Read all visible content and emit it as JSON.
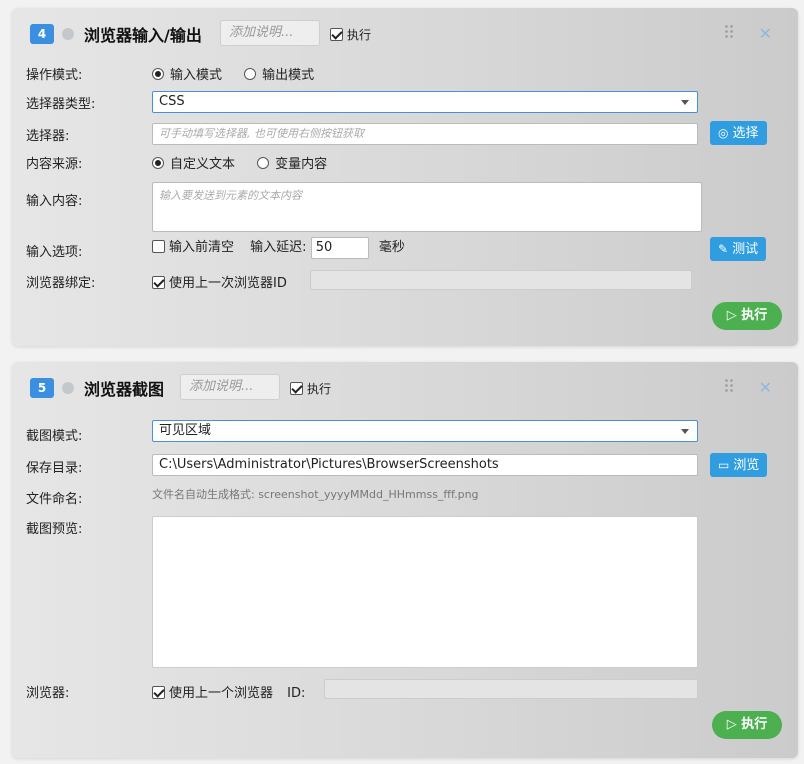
{
  "card1": {
    "index": "4",
    "title": "浏览器输入/输出",
    "desc_placeholder": "添加说明...",
    "exec_label": "执行",
    "op_mode": {
      "label": "操作模式:",
      "opt_input": "输入模式",
      "opt_output": "输出模式"
    },
    "selector_type": {
      "label": "选择器类型:",
      "value": "CSS"
    },
    "selector": {
      "label": "选择器:",
      "placeholder": "可手动填写选择器, 也可使用右侧按钮获取",
      "button": "选择"
    },
    "content_source": {
      "label": "内容来源:",
      "opt_custom": "自定义文本",
      "opt_variable": "变量内容"
    },
    "input_content": {
      "label": "输入内容:",
      "placeholder": "输入要发送到元素的文本内容"
    },
    "input_options": {
      "label": "输入选项:",
      "clear_label": "输入前清空",
      "delay_label": "输入延迟:",
      "delay_value": "50",
      "delay_unit": "毫秒",
      "test_button": "测试"
    },
    "browser_bind": {
      "label": "浏览器绑定:",
      "use_last_label": "使用上一次浏览器ID"
    },
    "run_button": "执行"
  },
  "card2": {
    "index": "5",
    "title": "浏览器截图",
    "desc_placeholder": "添加说明...",
    "exec_label": "执行",
    "mode": {
      "label": "截图模式:",
      "value": "可见区域"
    },
    "save_dir": {
      "label": "保存目录:",
      "value": "C:\\Users\\Administrator\\Pictures\\BrowserScreenshots",
      "button": "浏览"
    },
    "file_naming": {
      "label": "文件命名:",
      "hint": "文件名自动生成格式: screenshot_yyyyMMdd_HHmmss_fff.png"
    },
    "preview": {
      "label": "截图预览:"
    },
    "browser": {
      "label": "浏览器:",
      "use_last_label": "使用上一个浏览器",
      "id_label": "ID:"
    },
    "run_button": "执行"
  },
  "colors": {
    "accent": "#2f9de0",
    "badge": "#3b8fe0",
    "run_green": "#4caf50",
    "focus_border": "#4a90d9"
  }
}
